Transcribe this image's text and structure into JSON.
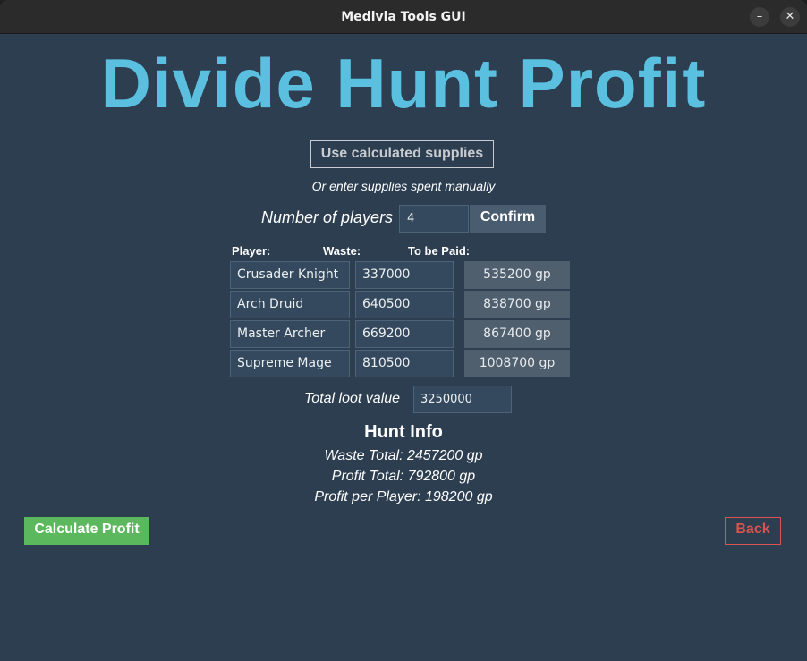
{
  "window": {
    "title": "Medivia Tools GUI",
    "minimize_glyph": "–",
    "close_glyph": "✕"
  },
  "app": {
    "title": "Divide Hunt Profit",
    "use_supplies_label": "Use calculated supplies",
    "manual_hint": "Or enter supplies spent manually",
    "players_label": "Number of players",
    "players_value": "4",
    "confirm_label": "Confirm"
  },
  "table": {
    "headers": {
      "player": "Player:",
      "waste": "Waste:",
      "paid": "To be Paid:"
    },
    "rows": [
      {
        "player": "Crusader Knight",
        "waste": "337000",
        "paid": "535200 gp"
      },
      {
        "player": "Arch Druid",
        "waste": "640500",
        "paid": "838700 gp"
      },
      {
        "player": "Master Archer",
        "waste": "669200",
        "paid": "867400 gp"
      },
      {
        "player": "Supreme Mage",
        "waste": "810500",
        "paid": "1008700 gp"
      }
    ]
  },
  "loot": {
    "label": "Total loot value",
    "value": "3250000"
  },
  "info": {
    "title": "Hunt Info",
    "waste_total": "Waste Total: 2457200 gp",
    "profit_total": "Profit Total: 792800 gp",
    "profit_per_player": "Profit per Player: 198200 gp"
  },
  "actions": {
    "calculate_label": "Calculate Profit",
    "back_label": "Back"
  },
  "colors": {
    "background": "#2c3e50",
    "title": "#5bbfe0",
    "calculate": "#5cb85c",
    "back": "#d9534f"
  }
}
